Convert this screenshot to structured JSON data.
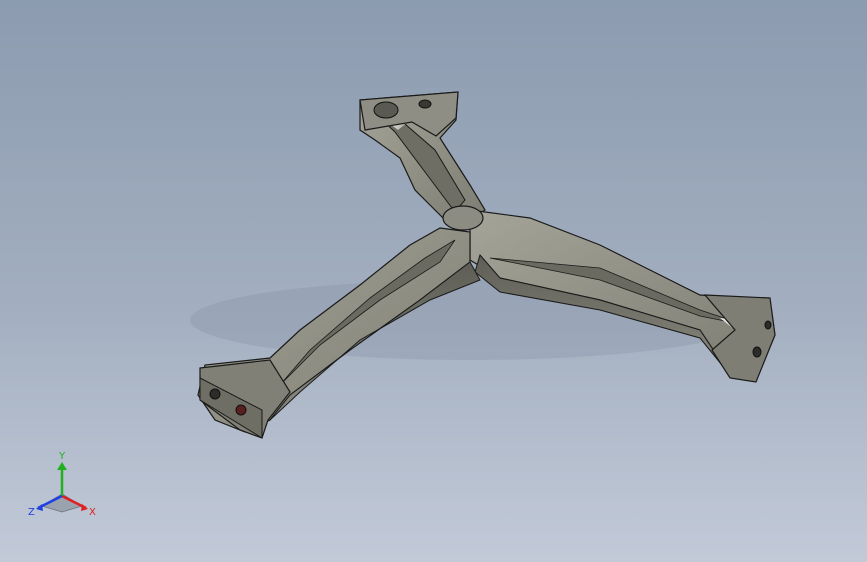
{
  "viewport": {
    "background_top": "#8c9bb0",
    "background_bottom": "#c2cad8"
  },
  "model": {
    "type": "3d-part-view",
    "material_color": "#8a8a80",
    "edge_color": "#1a1a1a"
  },
  "triad": {
    "x_label": "X",
    "y_label": "Y",
    "z_label": "Z",
    "x_color": "#e02020",
    "y_color": "#20b020",
    "z_color": "#2040e0"
  }
}
